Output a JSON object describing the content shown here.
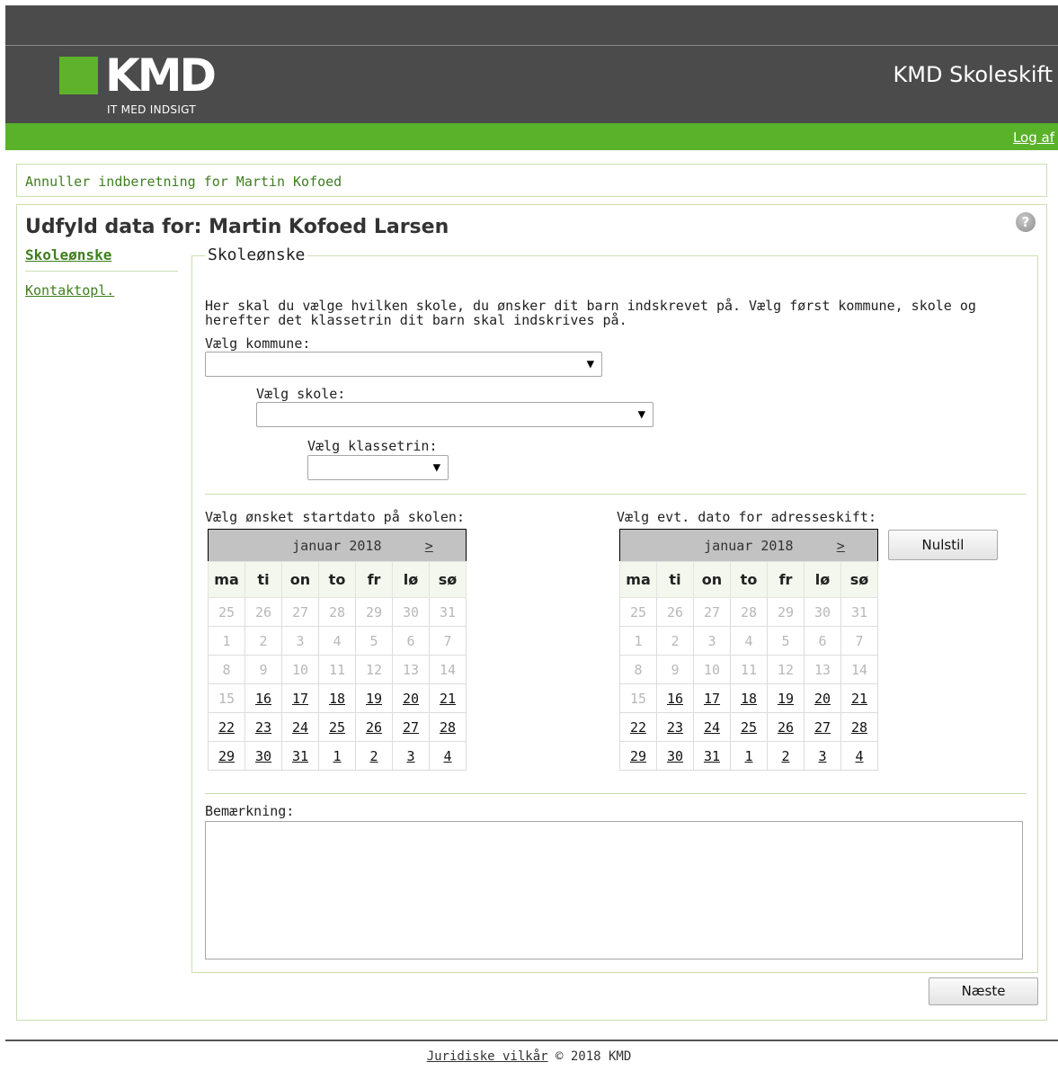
{
  "header": {
    "logo_text": "KMD",
    "logo_tagline": "IT MED INDSIGT",
    "app_title": "KMD Skoleskift",
    "logout_label": "Log af"
  },
  "cancel_link": "Annuller indberetning for Martin Kofoed",
  "page_title": "Udfyld data for: Martin Kofoed Larsen",
  "help_icon": "question-icon",
  "nav": {
    "active": "Skoleønske",
    "items": [
      "Kontaktopl."
    ]
  },
  "form": {
    "legend": "Skoleønske",
    "intro": "Her skal du vælge hvilken skole, du ønsker dit barn indskrevet på. Vælg først kommune, skole og herefter det klassetrin dit barn skal indskrives på.",
    "kommune_label": "Vælg kommune:",
    "kommune_value": "",
    "skole_label": "Vælg skole:",
    "skole_value": "",
    "klassetrin_label": "Vælg klassetrin:",
    "klassetrin_value": "",
    "startdate_label": "Vælg ønsket startdato på skolen:",
    "address_label": "Vælg evt. dato for adresseskift:",
    "reset_button": "Nulstil",
    "remark_label": "Bemærkning:",
    "remark_value": "",
    "next_button": "Næste",
    "dropdown_arrow": "▼"
  },
  "calendars": {
    "month": "januar 2018",
    "next": ">",
    "weekdays": [
      "ma",
      "ti",
      "on",
      "to",
      "fr",
      "lø",
      "sø"
    ],
    "weeks": [
      [
        "25",
        "26",
        "27",
        "28",
        "29",
        "30",
        "31"
      ],
      [
        "1",
        "2",
        "3",
        "4",
        "5",
        "6",
        "7"
      ],
      [
        "8",
        "9",
        "10",
        "11",
        "12",
        "13",
        "14"
      ],
      [
        "15",
        "16",
        "17",
        "18",
        "19",
        "20",
        "21"
      ],
      [
        "22",
        "23",
        "24",
        "25",
        "26",
        "27",
        "28"
      ],
      [
        "29",
        "30",
        "31",
        "1",
        "2",
        "3",
        "4"
      ]
    ],
    "first_selectable": "16"
  },
  "footer": {
    "terms_link": "Juridiske vilkår",
    "copyright": "© 2018 KMD"
  }
}
